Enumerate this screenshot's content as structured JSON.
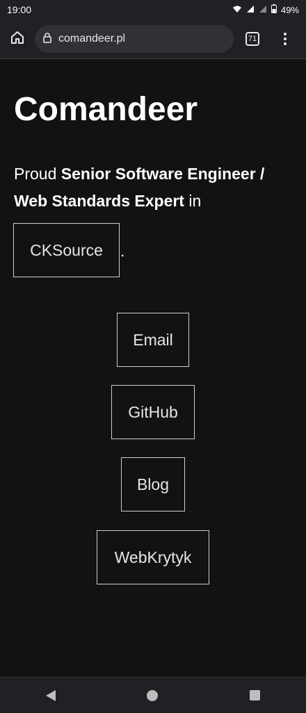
{
  "status_bar": {
    "time": "19:00",
    "battery": "49%",
    "icons": [
      "wifi-icon",
      "signal-icon",
      "signal-icon",
      "battery-icon"
    ]
  },
  "browser": {
    "url": "comandeer.pl",
    "tab_count": "71",
    "icons": [
      "home-icon",
      "lock-icon",
      "tabs-icon",
      "more-vert-icon"
    ]
  },
  "page": {
    "title": "Comandeer",
    "intro_prefix": "Proud ",
    "intro_bold": "Senior Software Engineer / Web Standards Expert",
    "intro_suffix": " in",
    "company_link": "CKSource",
    "period": ".",
    "links": [
      {
        "label": "Email"
      },
      {
        "label": "GitHub"
      },
      {
        "label": "Blog"
      },
      {
        "label": "WebKrytyk"
      }
    ]
  },
  "nav_bar": {
    "icons": [
      "back-icon",
      "home-circle-icon",
      "recents-icon"
    ]
  }
}
